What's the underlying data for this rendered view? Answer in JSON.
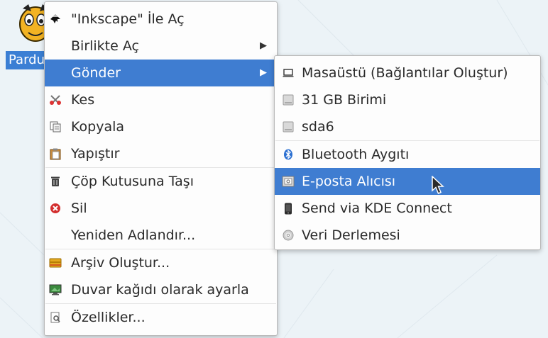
{
  "desktop": {
    "icon_label": "Pardu"
  },
  "main_menu": {
    "items": [
      {
        "label": "\"Inkscape\" İle Aç",
        "icon": "inkscape-icon"
      },
      {
        "label": "Birlikte Aç",
        "submenu": true
      },
      {
        "label": "Gönder",
        "submenu": true,
        "highlighted": true
      },
      {
        "label": "Kes",
        "icon": "scissors-icon"
      },
      {
        "label": "Kopyala",
        "icon": "copy-icon"
      },
      {
        "label": "Yapıştır",
        "icon": "clipboard-icon"
      },
      {
        "label": "Çöp Kutusuna Taşı",
        "icon": "trash-icon"
      },
      {
        "label": "Sil",
        "icon": "delete-icon"
      },
      {
        "label": "Yeniden Adlandır..."
      },
      {
        "label": "Arşiv Oluştur...",
        "icon": "archive-icon"
      },
      {
        "label": "Duvar kağıdı olarak ayarla",
        "icon": "wallpaper-icon"
      },
      {
        "label": "Özellikler...",
        "icon": "properties-icon"
      }
    ]
  },
  "send_submenu": {
    "items": [
      {
        "label": "Masaüstü (Bağlantılar Oluştur)",
        "icon": "desktop-icon"
      },
      {
        "label": "31 GB Birimi",
        "icon": "drive-icon"
      },
      {
        "label": "sda6",
        "icon": "drive-icon"
      },
      {
        "label": "Bluetooth Aygıtı",
        "icon": "bluetooth-icon"
      },
      {
        "label": "E-posta Alıcısı",
        "icon": "email-icon",
        "highlighted": true
      },
      {
        "label": "Send via KDE Connect",
        "icon": "phone-icon"
      },
      {
        "label": "Veri Derlemesi",
        "icon": "disc-icon"
      }
    ]
  },
  "colors": {
    "highlight": "#3f7dd1",
    "background": "#ecf3f7"
  }
}
